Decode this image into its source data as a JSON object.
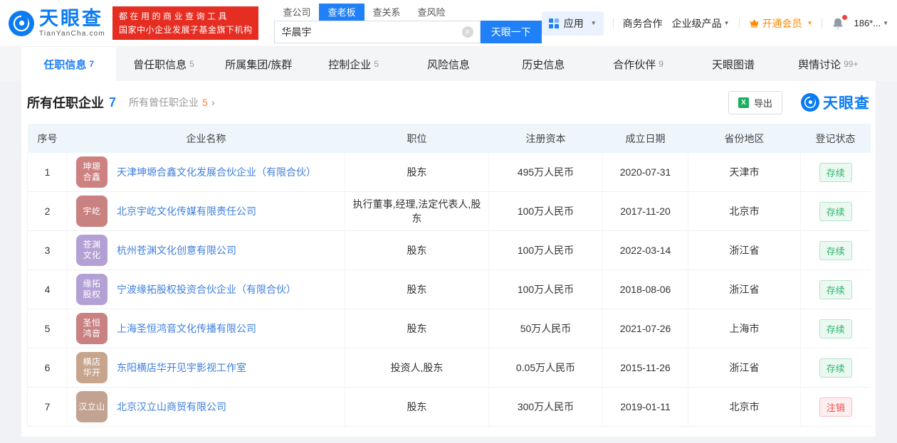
{
  "brand": {
    "logo_title": "天眼查",
    "logo_subtitle": "TianYanCha.com",
    "slogan_line1": "都在用的商业查询工具",
    "slogan_line2": "国家中小企业发展子基金旗下机构"
  },
  "search": {
    "tabs": [
      {
        "label": "查公司",
        "active": false
      },
      {
        "label": "查老板",
        "active": true
      },
      {
        "label": "查关系",
        "active": false
      },
      {
        "label": "查风险",
        "active": false
      }
    ],
    "value": "华晨宇",
    "button_label": "天眼一下"
  },
  "topnav": {
    "apps_label": "应用",
    "business_label": "商务合作",
    "enterprise_label": "企业级产品",
    "vip_label": "开通会员",
    "phone": "186*..."
  },
  "tabs": [
    {
      "label": "任职信息",
      "count": "7",
      "active": true
    },
    {
      "label": "曾任职信息",
      "count": "5",
      "active": false
    },
    {
      "label": "所属集团/族群",
      "count": "",
      "active": false
    },
    {
      "label": "控制企业",
      "count": "5",
      "active": false
    },
    {
      "label": "风险信息",
      "count": "",
      "active": false
    },
    {
      "label": "历史信息",
      "count": "",
      "active": false
    },
    {
      "label": "合作伙伴",
      "count": "9",
      "active": false
    },
    {
      "label": "天眼图谱",
      "count": "",
      "active": false
    },
    {
      "label": "舆情讨论",
      "count": "99+",
      "active": false
    }
  ],
  "section": {
    "title": "所有任职企业",
    "title_count": "7",
    "secondary": "所有曾任职企业",
    "secondary_count": "5",
    "export_label": "导出",
    "watermark_label": "天眼查"
  },
  "table": {
    "columns": [
      "序号",
      "企业名称",
      "职位",
      "注册资本",
      "成立日期",
      "省份地区",
      "登记状态"
    ],
    "rows": [
      {
        "no": "1",
        "badge_lines": [
          "坤塬",
          "合鑫"
        ],
        "badge_color": "#cd8181",
        "company": "天津坤塬合鑫文化发展合伙企业（有限合伙）",
        "position": "股东",
        "capital": "495万人民币",
        "date": "2020-07-31",
        "region": "天津市",
        "status": "存续",
        "status_type": "active"
      },
      {
        "no": "2",
        "badge_lines": [
          "宇屹"
        ],
        "badge_color": "#c98181",
        "company": "北京宇屹文化传媒有限责任公司",
        "position": "执行董事,经理,法定代表人,股东",
        "capital": "100万人民币",
        "date": "2017-11-20",
        "region": "北京市",
        "status": "存续",
        "status_type": "active"
      },
      {
        "no": "3",
        "badge_lines": [
          "苍渊",
          "文化"
        ],
        "badge_color": "#b3a1d6",
        "company": "杭州苍渊文化创意有限公司",
        "position": "股东",
        "capital": "100万人民币",
        "date": "2022-03-14",
        "region": "浙江省",
        "status": "存续",
        "status_type": "active"
      },
      {
        "no": "4",
        "badge_lines": [
          "缘拓",
          "股权"
        ],
        "badge_color": "#b3a1d6",
        "company": "宁波缘拓股权投资合伙企业（有限合伙）",
        "position": "股东",
        "capital": "100万人民币",
        "date": "2018-08-06",
        "region": "浙江省",
        "status": "存续",
        "status_type": "active"
      },
      {
        "no": "5",
        "badge_lines": [
          "圣恒",
          "鸿音"
        ],
        "badge_color": "#c98181",
        "company": "上海圣恒鸿音文化传播有限公司",
        "position": "股东",
        "capital": "50万人民币",
        "date": "2021-07-26",
        "region": "上海市",
        "status": "存续",
        "status_type": "active"
      },
      {
        "no": "6",
        "badge_lines": [
          "横店",
          "华开"
        ],
        "badge_color": "#c7a58c",
        "company": "东阳横店华开见宇影视工作室",
        "position": "投资人,股东",
        "capital": "0.05万人民币",
        "date": "2015-11-26",
        "region": "浙江省",
        "status": "存续",
        "status_type": "active"
      },
      {
        "no": "7",
        "badge_lines": [
          "汉立山"
        ],
        "badge_color": "#c2a392",
        "company": "北京汉立山商贸有限公司",
        "position": "股东",
        "capital": "300万人民币",
        "date": "2019-01-11",
        "region": "北京市",
        "status": "注销",
        "status_type": "cancelled"
      }
    ]
  },
  "icons": {
    "caret_down": "▼",
    "clear": "×",
    "arrow_right": "›",
    "excel": "X"
  },
  "colors": {
    "brand_blue": "#0b7bf2",
    "button_blue": "#2080f7",
    "slogan_red": "#e62d22",
    "vip_orange": "#ff8a00",
    "link_blue": "#3e7fdc",
    "count_orange": "#ff8040",
    "status_active_green": "#2bb56a",
    "status_cancelled_red": "#f04848",
    "table_header_bg": "#eef6fc"
  }
}
